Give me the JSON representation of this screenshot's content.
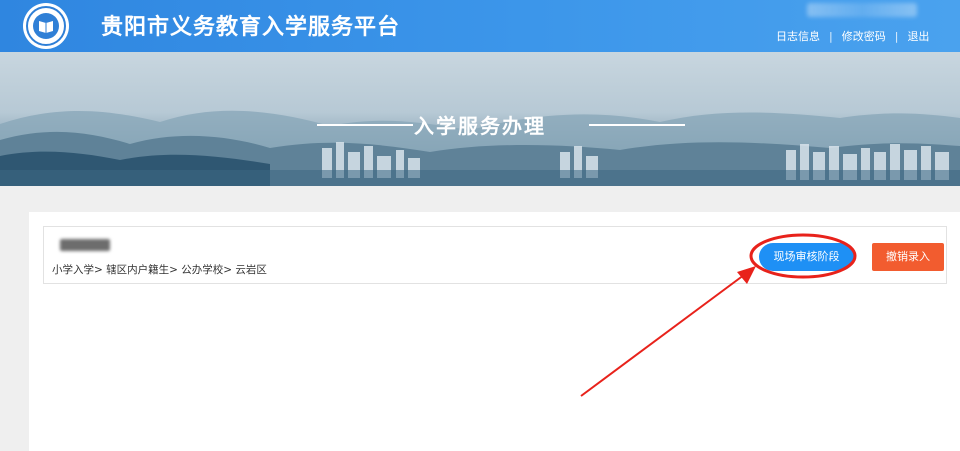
{
  "header": {
    "title": "贵阳市义务教育入学服务平台",
    "links": {
      "log": "日志信息",
      "password": "修改密码",
      "logout": "退出"
    },
    "separator": "|"
  },
  "banner": {
    "title": "入学服务办理"
  },
  "record": {
    "path": "小学入学> 辖区内户籍生> 公办学校> 云岩区",
    "buttons": {
      "review_stage": "现场审核阶段",
      "cancel_entry": "撤销录入"
    }
  },
  "colors": {
    "header_blue": "#2f86e0",
    "review_button": "#1e90f5",
    "cancel_button": "#f25c2f",
    "annotation_red": "#e8221b"
  },
  "icons": {
    "logo": "school-emblem-logo"
  }
}
